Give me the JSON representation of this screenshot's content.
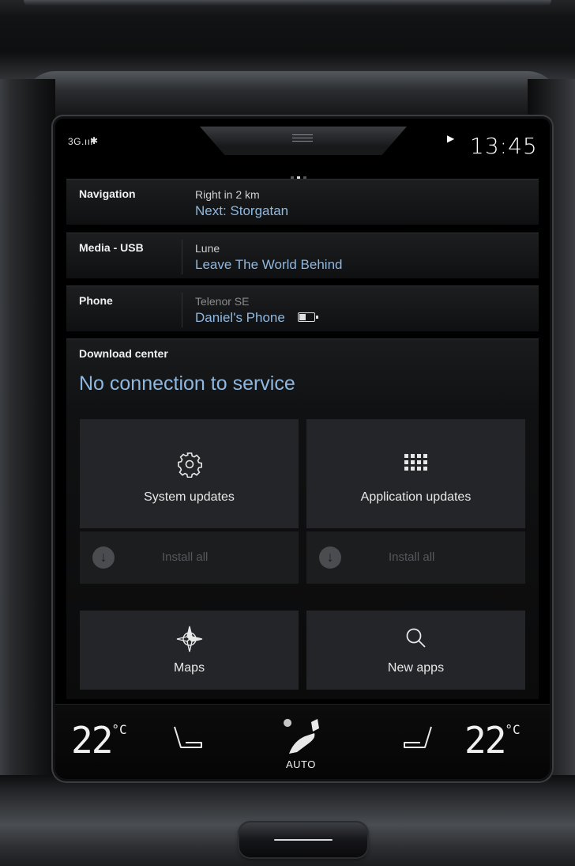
{
  "status": {
    "signal": "3G.ııl",
    "bluetooth": "✱",
    "play_icon": "▶",
    "time": "13:45"
  },
  "rows": [
    {
      "label": "Navigation",
      "line1": "Right in 2 km",
      "line2": "Next: Storgatan"
    },
    {
      "label": "Media - USB",
      "line1": "Lune",
      "line2": "Leave The World Behind"
    },
    {
      "label": "Phone",
      "line1": "Telenor SE",
      "line2": "Daniel's Phone"
    }
  ],
  "download_center": {
    "title": "Download center",
    "message": "No connection to service",
    "system_updates": "System updates",
    "application_updates": "Application updates",
    "install_all_left": "Install all",
    "install_all_right": "Install all"
  },
  "apps": {
    "maps": "Maps",
    "new_apps": "New apps"
  },
  "climate": {
    "left_temp": "22",
    "right_temp": "22",
    "unit": "°C",
    "auto": "AUTO"
  },
  "colors": {
    "accent_blue": "#8fb8e0",
    "tile_bg": "#242528",
    "screen_bg": "#000000"
  }
}
